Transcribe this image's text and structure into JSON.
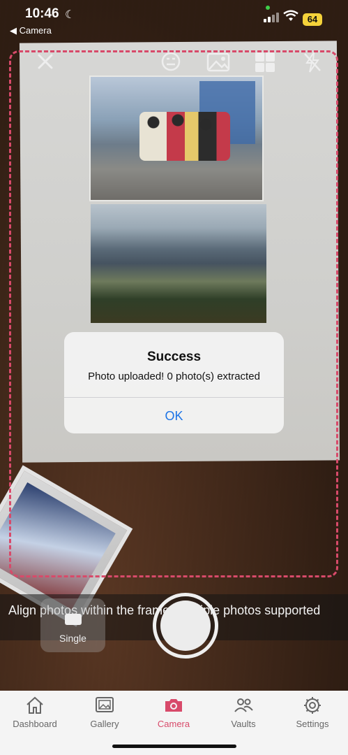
{
  "status_bar": {
    "time": "10:46",
    "back_label": "◀ Camera",
    "battery": "64"
  },
  "dialog": {
    "title": "Success",
    "message": "Photo uploaded! 0 photo(s) extracted",
    "ok_label": "OK"
  },
  "hint": "Align photos within the frame. Multiple photos supported",
  "mode": {
    "label": "Single"
  },
  "tabs": [
    {
      "label": "Dashboard",
      "icon": "home-icon"
    },
    {
      "label": "Gallery",
      "icon": "gallery-icon"
    },
    {
      "label": "Camera",
      "icon": "camera-icon",
      "active": true
    },
    {
      "label": "Vaults",
      "icon": "vaults-icon"
    },
    {
      "label": "Settings",
      "icon": "gear-icon"
    }
  ],
  "colors": {
    "accent": "#d84a6a",
    "link": "#1d74e6"
  }
}
